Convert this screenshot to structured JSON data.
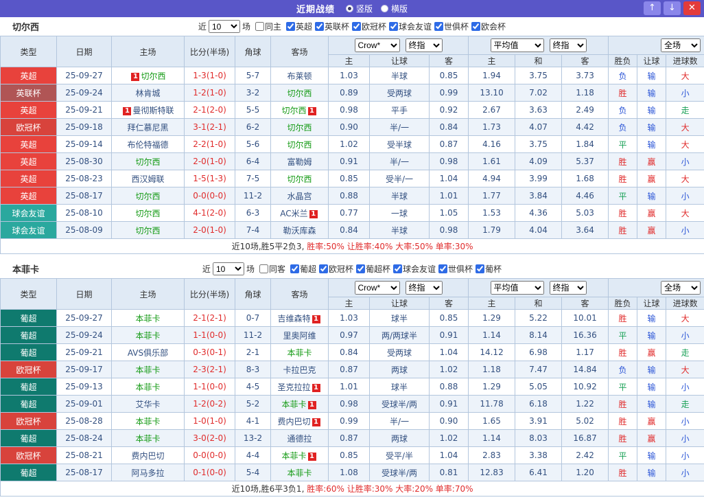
{
  "titlebar": {
    "title": "近期战绩",
    "radios": [
      "竖版",
      "横版"
    ],
    "selected": "竖版",
    "up": "↑",
    "down": "↓",
    "close": "✕"
  },
  "red_card_badge": "1",
  "league_colors": {
    "英超": "#e8423c",
    "英联杯": "#b05555",
    "欧冠杯": "#d8433c",
    "球会友谊": "#2aa89e",
    "葡超": "#0f7a6e"
  },
  "value_colors": {
    "胜": "#e02b2b",
    "平": "#18a055",
    "负": "#2b55d6",
    "赢": "#e02b2b",
    "输": "#2b55d6",
    "大": "#e02b2b",
    "小": "#2b55d6",
    "走": "#18a055"
  },
  "sections": [
    {
      "team": "切尔西",
      "filter": {
        "near": "近",
        "count": "10",
        "games": "场",
        "same": {
          "label": "同主",
          "checked": false
        },
        "leagues": [
          {
            "label": "英超",
            "checked": true
          },
          {
            "label": "英联杯",
            "checked": true
          },
          {
            "label": "欧冠杯",
            "checked": true
          },
          {
            "label": "球会友谊",
            "checked": true
          },
          {
            "label": "世俱杯",
            "checked": true
          },
          {
            "label": "欧会杯",
            "checked": true
          }
        ]
      },
      "header": {
        "type": "类型",
        "date": "日期",
        "home": "主场",
        "score": "比分(半场)",
        "corner": "角球",
        "away": "客场",
        "sel_crow": "Crow*",
        "sel_final1": "终指",
        "sel_avg": "平均值",
        "sel_final2": "终指",
        "sel_scope": "全场",
        "sub": [
          "主",
          "让球",
          "客",
          "主",
          "和",
          "客",
          "胜负",
          "让球",
          "进球数"
        ]
      },
      "rows": [
        {
          "league": "英超",
          "date": "25-09-27",
          "home": {
            "name": "切尔西",
            "focus": true,
            "rc": "1",
            "rc_pos": "before"
          },
          "score": "1-3(1-0)",
          "corner": "5-7",
          "away": {
            "name": "布莱顿",
            "focus": false,
            "rc": ""
          },
          "odds": [
            "1.03",
            "半球",
            "0.85"
          ],
          "avg": [
            "1.94",
            "3.75",
            "3.73"
          ],
          "result": "负",
          "cover": "输",
          "goal": "大"
        },
        {
          "league": "英联杯",
          "date": "25-09-24",
          "home": {
            "name": "林肯城",
            "focus": false,
            "rc": ""
          },
          "score": "1-2(1-0)",
          "corner": "3-2",
          "away": {
            "name": "切尔西",
            "focus": true,
            "rc": ""
          },
          "odds": [
            "0.89",
            "受两球",
            "0.99"
          ],
          "avg": [
            "13.10",
            "7.02",
            "1.18"
          ],
          "result": "胜",
          "cover": "输",
          "goal": "小"
        },
        {
          "league": "英超",
          "date": "25-09-21",
          "home": {
            "name": "曼彻斯特联",
            "focus": false,
            "rc": "1",
            "rc_pos": "before"
          },
          "score": "2-1(2-0)",
          "corner": "5-5",
          "away": {
            "name": "切尔西",
            "focus": true,
            "rc": "1",
            "rc_pos": "after"
          },
          "odds": [
            "0.98",
            "平手",
            "0.92"
          ],
          "avg": [
            "2.67",
            "3.63",
            "2.49"
          ],
          "result": "负",
          "cover": "输",
          "goal": "走"
        },
        {
          "league": "欧冠杯",
          "date": "25-09-18",
          "home": {
            "name": "拜仁慕尼黑",
            "focus": false,
            "rc": ""
          },
          "score": "3-1(2-1)",
          "corner": "6-2",
          "away": {
            "name": "切尔西",
            "focus": true,
            "rc": ""
          },
          "odds": [
            "0.90",
            "半/一",
            "0.84"
          ],
          "avg": [
            "1.73",
            "4.07",
            "4.42"
          ],
          "result": "负",
          "cover": "输",
          "goal": "大"
        },
        {
          "league": "英超",
          "date": "25-09-14",
          "home": {
            "name": "布伦特福德",
            "focus": false,
            "rc": ""
          },
          "score": "2-2(1-0)",
          "corner": "5-6",
          "away": {
            "name": "切尔西",
            "focus": true,
            "rc": ""
          },
          "odds": [
            "1.02",
            "受半球",
            "0.87"
          ],
          "avg": [
            "4.16",
            "3.75",
            "1.84"
          ],
          "result": "平",
          "cover": "输",
          "goal": "大"
        },
        {
          "league": "英超",
          "date": "25-08-30",
          "home": {
            "name": "切尔西",
            "focus": true,
            "rc": ""
          },
          "score": "2-0(1-0)",
          "corner": "6-4",
          "away": {
            "name": "富勒姆",
            "focus": false,
            "rc": ""
          },
          "odds": [
            "0.91",
            "半/一",
            "0.98"
          ],
          "avg": [
            "1.61",
            "4.09",
            "5.37"
          ],
          "result": "胜",
          "cover": "赢",
          "goal": "小"
        },
        {
          "league": "英超",
          "date": "25-08-23",
          "home": {
            "name": "西汉姆联",
            "focus": false,
            "rc": ""
          },
          "score": "1-5(1-3)",
          "corner": "7-5",
          "away": {
            "name": "切尔西",
            "focus": true,
            "rc": ""
          },
          "odds": [
            "0.85",
            "受半/一",
            "1.04"
          ],
          "avg": [
            "4.94",
            "3.99",
            "1.68"
          ],
          "result": "胜",
          "cover": "赢",
          "goal": "大"
        },
        {
          "league": "英超",
          "date": "25-08-17",
          "home": {
            "name": "切尔西",
            "focus": true,
            "rc": ""
          },
          "score": "0-0(0-0)",
          "corner": "11-2",
          "away": {
            "name": "水晶宫",
            "focus": false,
            "rc": ""
          },
          "odds": [
            "0.88",
            "半球",
            "1.01"
          ],
          "avg": [
            "1.77",
            "3.84",
            "4.46"
          ],
          "result": "平",
          "cover": "输",
          "goal": "小"
        },
        {
          "league": "球会友谊",
          "date": "25-08-10",
          "home": {
            "name": "切尔西",
            "focus": true,
            "rc": ""
          },
          "score": "4-1(2-0)",
          "corner": "6-3",
          "away": {
            "name": "AC米兰",
            "focus": false,
            "rc": "1",
            "rc_pos": "after"
          },
          "odds": [
            "0.77",
            "一球",
            "1.05"
          ],
          "avg": [
            "1.53",
            "4.36",
            "5.03"
          ],
          "result": "胜",
          "cover": "赢",
          "goal": "大"
        },
        {
          "league": "球会友谊",
          "date": "25-08-09",
          "home": {
            "name": "切尔西",
            "focus": true,
            "rc": ""
          },
          "score": "2-0(1-0)",
          "corner": "7-4",
          "away": {
            "name": "勒沃库森",
            "focus": false,
            "rc": ""
          },
          "odds": [
            "0.84",
            "半球",
            "0.98"
          ],
          "avg": [
            "1.79",
            "4.04",
            "3.64"
          ],
          "result": "胜",
          "cover": "赢",
          "goal": "小"
        }
      ],
      "summary": {
        "prefix": "近10场,胜5平2负3, ",
        "stats": "胜率:50% 让胜率:40% 大率:50% 单率:30%"
      }
    },
    {
      "team": "本菲卡",
      "filter": {
        "near": "近",
        "count": "10",
        "games": "场",
        "same": {
          "label": "同客",
          "checked": false
        },
        "leagues": [
          {
            "label": "葡超",
            "checked": true
          },
          {
            "label": "欧冠杯",
            "checked": true
          },
          {
            "label": "葡超杯",
            "checked": true
          },
          {
            "label": "球会友谊",
            "checked": true
          },
          {
            "label": "世俱杯",
            "checked": true
          },
          {
            "label": "葡杯",
            "checked": true
          }
        ]
      },
      "header": {
        "type": "类型",
        "date": "日期",
        "home": "主场",
        "score": "比分(半场)",
        "corner": "角球",
        "away": "客场",
        "sel_crow": "Crow*",
        "sel_final1": "终指",
        "sel_avg": "平均值",
        "sel_final2": "终指",
        "sel_scope": "全场",
        "sub": [
          "主",
          "让球",
          "客",
          "主",
          "和",
          "客",
          "胜负",
          "让球",
          "进球数"
        ]
      },
      "rows": [
        {
          "league": "葡超",
          "date": "25-09-27",
          "home": {
            "name": "本菲卡",
            "focus": true,
            "rc": ""
          },
          "score": "2-1(2-1)",
          "corner": "0-7",
          "away": {
            "name": "吉维森特",
            "focus": false,
            "rc": "1",
            "rc_pos": "after"
          },
          "odds": [
            "1.03",
            "球半",
            "0.85"
          ],
          "avg": [
            "1.29",
            "5.22",
            "10.01"
          ],
          "result": "胜",
          "cover": "输",
          "goal": "大"
        },
        {
          "league": "葡超",
          "date": "25-09-24",
          "home": {
            "name": "本菲卡",
            "focus": true,
            "rc": ""
          },
          "score": "1-1(0-0)",
          "corner": "11-2",
          "away": {
            "name": "里奥阿维",
            "focus": false,
            "rc": ""
          },
          "odds": [
            "0.97",
            "两/两球半",
            "0.91"
          ],
          "avg": [
            "1.14",
            "8.14",
            "16.36"
          ],
          "result": "平",
          "cover": "输",
          "goal": "小"
        },
        {
          "league": "葡超",
          "date": "25-09-21",
          "home": {
            "name": "AVS俱乐部",
            "focus": false,
            "rc": ""
          },
          "score": "0-3(0-1)",
          "corner": "2-1",
          "away": {
            "name": "本菲卡",
            "focus": true,
            "rc": ""
          },
          "odds": [
            "0.84",
            "受两球",
            "1.04"
          ],
          "avg": [
            "14.12",
            "6.98",
            "1.17"
          ],
          "result": "胜",
          "cover": "赢",
          "goal": "走"
        },
        {
          "league": "欧冠杯",
          "date": "25-09-17",
          "home": {
            "name": "本菲卡",
            "focus": true,
            "rc": ""
          },
          "score": "2-3(2-1)",
          "corner": "8-3",
          "away": {
            "name": "卡拉巴克",
            "focus": false,
            "rc": ""
          },
          "odds": [
            "0.87",
            "两球",
            "1.02"
          ],
          "avg": [
            "1.18",
            "7.47",
            "14.84"
          ],
          "result": "负",
          "cover": "输",
          "goal": "大"
        },
        {
          "league": "葡超",
          "date": "25-09-13",
          "home": {
            "name": "本菲卡",
            "focus": true,
            "rc": ""
          },
          "score": "1-1(0-0)",
          "corner": "4-5",
          "away": {
            "name": "圣克拉拉",
            "focus": false,
            "rc": "1",
            "rc_pos": "after"
          },
          "odds": [
            "1.01",
            "球半",
            "0.88"
          ],
          "avg": [
            "1.29",
            "5.05",
            "10.92"
          ],
          "result": "平",
          "cover": "输",
          "goal": "小"
        },
        {
          "league": "葡超",
          "date": "25-09-01",
          "home": {
            "name": "艾华卡",
            "focus": false,
            "rc": ""
          },
          "score": "1-2(0-2)",
          "corner": "5-2",
          "away": {
            "name": "本菲卡",
            "focus": true,
            "rc": "1",
            "rc_pos": "after"
          },
          "odds": [
            "0.98",
            "受球半/两",
            "0.91"
          ],
          "avg": [
            "11.78",
            "6.18",
            "1.22"
          ],
          "result": "胜",
          "cover": "输",
          "goal": "走"
        },
        {
          "league": "欧冠杯",
          "date": "25-08-28",
          "home": {
            "name": "本菲卡",
            "focus": true,
            "rc": ""
          },
          "score": "1-0(1-0)",
          "corner": "4-1",
          "away": {
            "name": "费内巴切",
            "focus": false,
            "rc": "1",
            "rc_pos": "after"
          },
          "odds": [
            "0.99",
            "半/一",
            "0.90"
          ],
          "avg": [
            "1.65",
            "3.91",
            "5.02"
          ],
          "result": "胜",
          "cover": "赢",
          "goal": "小"
        },
        {
          "league": "葡超",
          "date": "25-08-24",
          "home": {
            "name": "本菲卡",
            "focus": true,
            "rc": ""
          },
          "score": "3-0(2-0)",
          "corner": "13-2",
          "away": {
            "name": "通德拉",
            "focus": false,
            "rc": ""
          },
          "odds": [
            "0.87",
            "两球",
            "1.02"
          ],
          "avg": [
            "1.14",
            "8.03",
            "16.87"
          ],
          "result": "胜",
          "cover": "赢",
          "goal": "小"
        },
        {
          "league": "欧冠杯",
          "date": "25-08-21",
          "home": {
            "name": "费内巴切",
            "focus": false,
            "rc": ""
          },
          "score": "0-0(0-0)",
          "corner": "4-4",
          "away": {
            "name": "本菲卡",
            "focus": true,
            "rc": "1",
            "rc_pos": "after"
          },
          "odds": [
            "0.85",
            "受平/半",
            "1.04"
          ],
          "avg": [
            "2.83",
            "3.38",
            "2.42"
          ],
          "result": "平",
          "cover": "输",
          "goal": "小"
        },
        {
          "league": "葡超",
          "date": "25-08-17",
          "home": {
            "name": "阿马多拉",
            "focus": false,
            "rc": ""
          },
          "score": "0-1(0-0)",
          "corner": "5-4",
          "away": {
            "name": "本菲卡",
            "focus": true,
            "rc": ""
          },
          "odds": [
            "1.08",
            "受球半/两",
            "0.81"
          ],
          "avg": [
            "12.83",
            "6.41",
            "1.20"
          ],
          "result": "胜",
          "cover": "输",
          "goal": "小"
        }
      ],
      "summary": {
        "prefix": "近10场,胜6平3负1, ",
        "stats": "胜率:60% 让胜率:30% 大率:20% 单率:70%"
      }
    }
  ]
}
